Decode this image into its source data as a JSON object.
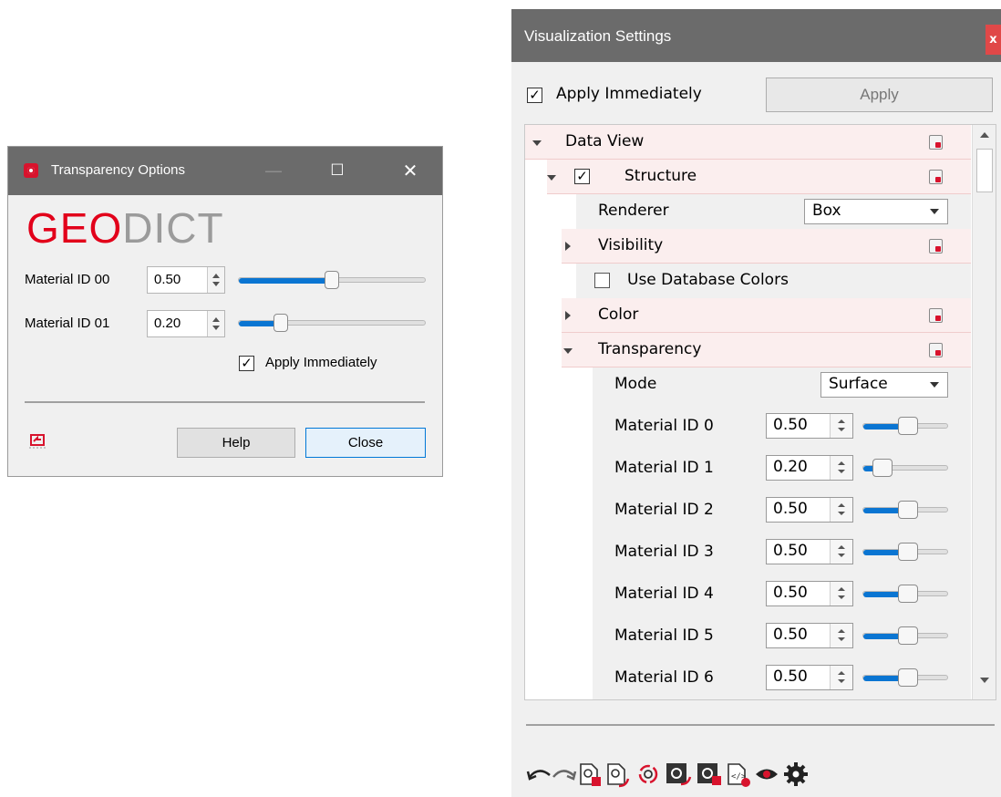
{
  "transparency_dialog": {
    "title": "Transparency Options",
    "minimize_glyph": "—",
    "maximize_glyph": "☐",
    "close_glyph": "✕",
    "logo": {
      "geo": "GEO",
      "dict": "DICT"
    },
    "materials": [
      {
        "label": "Material ID 00",
        "value": "0.50",
        "level": 0.5
      },
      {
        "label": "Material ID 01",
        "value": "0.20",
        "level": 0.2
      }
    ],
    "apply_immediately": {
      "label": "Apply Immediately",
      "checked": true,
      "mark": "✓"
    },
    "buttons": {
      "help": "Help",
      "close": "Close"
    },
    "icons": [
      "screen-share-icon"
    ],
    "colors": {
      "titlebar": "#6b6b6b",
      "brand_red": "#e2001a",
      "slider_fill": "#0a75d2"
    }
  },
  "vis_settings": {
    "title": "Visualization Settings",
    "close_glyph": "x",
    "apply_immediately": {
      "label": "Apply Immediately",
      "checked": true,
      "mark": "✓"
    },
    "apply_button": "Apply",
    "tree": {
      "data_view": "Data View",
      "structure": {
        "label": "Structure",
        "checked": true,
        "mark": "✓"
      },
      "renderer": {
        "label": "Renderer",
        "value": "Box"
      },
      "visibility": "Visibility",
      "use_db_colors": {
        "label": "Use Database Colors",
        "checked": false
      },
      "color": "Color",
      "transparency": "Transparency",
      "mode": {
        "label": "Mode",
        "value": "Surface"
      },
      "materials": [
        {
          "label": "Material ID 0",
          "value": "0.50",
          "level": 0.5
        },
        {
          "label": "Material ID 1",
          "value": "0.20",
          "level": 0.2
        },
        {
          "label": "Material ID 2",
          "value": "0.50",
          "level": 0.5
        },
        {
          "label": "Material ID 3",
          "value": "0.50",
          "level": 0.5
        },
        {
          "label": "Material ID 4",
          "value": "0.50",
          "level": 0.5
        },
        {
          "label": "Material ID 5",
          "value": "0.50",
          "level": 0.5
        },
        {
          "label": "Material ID 6",
          "value": "0.50",
          "level": 0.5
        }
      ]
    },
    "toolbar_icons": [
      "undo-icon",
      "redo-icon",
      "save-settings-icon",
      "load-settings-icon",
      "refresh-settings-icon",
      "dark-settings-icon",
      "dark-save-icon",
      "script-icon",
      "eye-icon",
      "gear-icon"
    ]
  }
}
